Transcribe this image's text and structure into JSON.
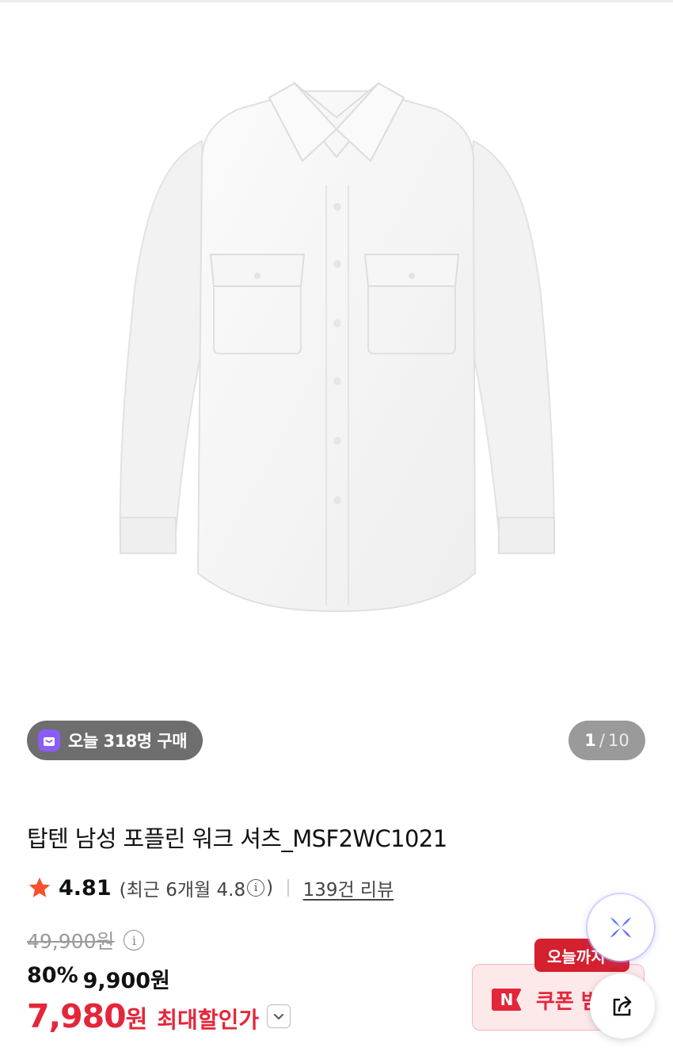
{
  "gallery": {
    "today_purchases": "오늘 318명 구매",
    "page_current": "1",
    "page_separator": "/",
    "page_total": "10"
  },
  "product": {
    "title": "탑텐 남성 포플린 워크 셔츠_MSF2WC1021",
    "rating": "4.81",
    "rating_recent_prefix": "(최근 6개월 4.8",
    "rating_recent_suffix": ")",
    "review_link": "139건 리뷰"
  },
  "price": {
    "original": "49,900원",
    "discount_rate": "80%",
    "discounted": "9,900원",
    "final_amount": "7,980",
    "final_unit": "원",
    "max_discount_label": "최대할인가"
  },
  "coupon": {
    "deadline_label": "오늘까지",
    "button_label": "쿠폰 받기",
    "naver_badge": "N"
  },
  "colors": {
    "accent_red": "#e4263b",
    "badge_purple": "#8b5cf6",
    "star": "#f4512c"
  },
  "icons": [
    "shopping-bag-icon",
    "star-icon",
    "info-icon",
    "chevron-down-icon",
    "naver-n-icon",
    "ai-sparkle-icon",
    "share-icon"
  ]
}
